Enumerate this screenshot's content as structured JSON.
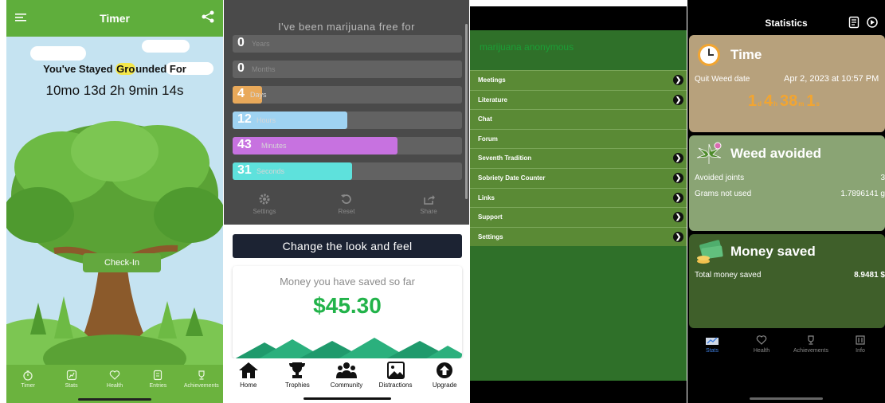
{
  "timer_screen": {
    "title": "Timer",
    "headline_pre": "You've Stayed ",
    "headline_hl": "Gro",
    "headline_post": "unded For",
    "counter": "10mo 13d 2h 9min 14s",
    "checkin_label": "Check-In",
    "tabs": [
      {
        "label": "Timer",
        "icon": "stopwatch-icon"
      },
      {
        "label": "Stats",
        "icon": "chart-icon"
      },
      {
        "label": "Health",
        "icon": "heart-icon"
      },
      {
        "label": "Entries",
        "icon": "journal-icon"
      },
      {
        "label": "Achievements",
        "icon": "trophy-icon"
      }
    ],
    "colors": {
      "accent": "#5fae3c",
      "sky": "#c5e3f1",
      "highlight": "#f3e64a"
    }
  },
  "free_screen": {
    "title": "I've been marijuana free for",
    "bars": [
      {
        "value": "0",
        "unit": "Years",
        "fill_pct": 0,
        "color": "#626262"
      },
      {
        "value": "0",
        "unit": "Months",
        "fill_pct": 0,
        "color": "#626262"
      },
      {
        "value": "4",
        "unit": "Days",
        "fill_pct": 13,
        "color": "#e9a95a"
      },
      {
        "value": "12",
        "unit": "Hours",
        "fill_pct": 50,
        "color": "#9fd3f2"
      },
      {
        "value": "43",
        "unit": "Minutes",
        "fill_pct": 72,
        "color": "#c772e0"
      },
      {
        "value": "31",
        "unit": "Seconds",
        "fill_pct": 52,
        "color": "#5ee1dc"
      }
    ],
    "controls": [
      {
        "label": "Settings",
        "icon": "gear-icon"
      },
      {
        "label": "Reset",
        "icon": "reset-icon"
      },
      {
        "label": "Share",
        "icon": "share-icon"
      }
    ],
    "change_look_label": "Change the look and feel",
    "money_label": "Money you have saved so far",
    "money_amount": "$45.30",
    "tabs": [
      {
        "label": "Home",
        "icon": "home-icon"
      },
      {
        "label": "Trophies",
        "icon": "trophy-icon"
      },
      {
        "label": "Community",
        "icon": "community-icon"
      },
      {
        "label": "Distractions",
        "icon": "image-icon"
      },
      {
        "label": "Upgrade",
        "icon": "upgrade-icon"
      }
    ]
  },
  "ma_screen": {
    "brand": "marijuana anonymous",
    "menu": [
      {
        "label": "Meetings",
        "arrow": true
      },
      {
        "label": "Literature",
        "arrow": true
      },
      {
        "label": "Chat",
        "arrow": false
      },
      {
        "label": "Forum",
        "arrow": false
      },
      {
        "label": "Seventh Tradition",
        "arrow": true
      },
      {
        "label": "Sobriety Date Counter",
        "arrow": true
      },
      {
        "label": "Links",
        "arrow": true
      },
      {
        "label": "Support",
        "arrow": true
      },
      {
        "label": "Settings",
        "arrow": true
      }
    ],
    "arrow_glyph": "❯"
  },
  "stats_screen": {
    "title": "Statistics",
    "time_card": {
      "title": "Time",
      "quit_label": "Quit Weed date",
      "quit_value": "Apr 2, 2023 at 10:57 PM",
      "days": "1",
      "days_unit": "d",
      "hours": "4",
      "hours_unit": "h",
      "minutes": "38",
      "minutes_unit": "m",
      "seconds": "1",
      "seconds_unit": "s",
      "color": "#b7a17c"
    },
    "weed_card": {
      "title": "Weed avoided",
      "joints_label": "Avoided joints",
      "joints_value": "3",
      "grams_label": "Grams not used",
      "grams_value": "1.7896141 g",
      "color": "#8aa474"
    },
    "money_card": {
      "title": "Money saved",
      "total_label": "Total money saved",
      "total_value": "8.9481 $",
      "color": "#3f5f2a"
    },
    "tabs": [
      {
        "label": "Stats",
        "icon": "stats-icon",
        "active": true
      },
      {
        "label": "Health",
        "icon": "heart-icon",
        "active": false
      },
      {
        "label": "Achievements",
        "icon": "trophy-icon",
        "active": false
      },
      {
        "label": "Info",
        "icon": "info-icon",
        "active": false
      }
    ]
  }
}
